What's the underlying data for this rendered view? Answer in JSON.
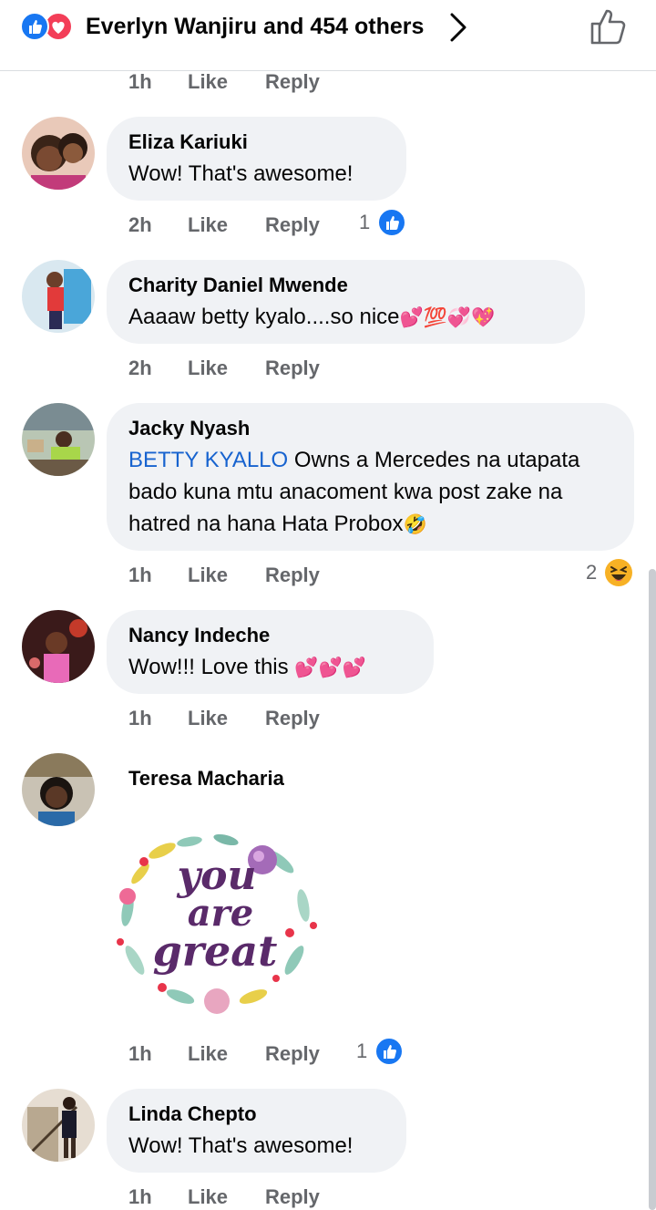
{
  "header": {
    "reactions_text": "Everlyn Wanjiru and 454 others",
    "reaction_icons": [
      "like-icon",
      "love-icon"
    ]
  },
  "top_meta": {
    "time": "1h",
    "like": "Like",
    "reply": "Reply"
  },
  "comments": [
    {
      "author": "Eliza Kariuki",
      "text": "Wow! That's awesome!",
      "time": "2h",
      "like": "Like",
      "reply": "Reply",
      "reaction_count": "1",
      "reaction_icon": "like-icon"
    },
    {
      "author": "Charity Daniel Mwende",
      "text": "Aaaaw betty kyalo....so nice",
      "emojis": "💕💯💞💖",
      "time": "2h",
      "like": "Like",
      "reply": "Reply"
    },
    {
      "author": "Jacky Nyash",
      "mention": "BETTY KYALLO",
      "text": " Owns a Mercedes na utapata bado kuna mtu anacoment kwa post zake na hatred na hana Hata Probox",
      "emojis": "🤣",
      "time": "1h",
      "like": "Like",
      "reply": "Reply",
      "reaction_count": "2",
      "reaction_icon": "haha-icon"
    },
    {
      "author": "Nancy Indeche",
      "text": "Wow!!! Love this ",
      "emojis": "💕💕💕",
      "time": "1h",
      "like": "Like",
      "reply": "Reply"
    },
    {
      "author": "Teresa Macharia",
      "sticker_text": [
        "you",
        "are",
        "great"
      ],
      "time": "1h",
      "like": "Like",
      "reply": "Reply",
      "reaction_count": "1",
      "reaction_icon": "like-icon"
    },
    {
      "author": "Linda Chepto",
      "text": "Wow! That's awesome!",
      "time": "1h",
      "like": "Like",
      "reply": "Reply"
    }
  ],
  "colors": {
    "like_blue": "#1877f2",
    "love_red": "#f33e58",
    "bubble_gray": "#f0f2f5",
    "meta_gray": "#65676b",
    "mention_blue": "#1763cf",
    "haha_yellow": "#f7b125"
  }
}
